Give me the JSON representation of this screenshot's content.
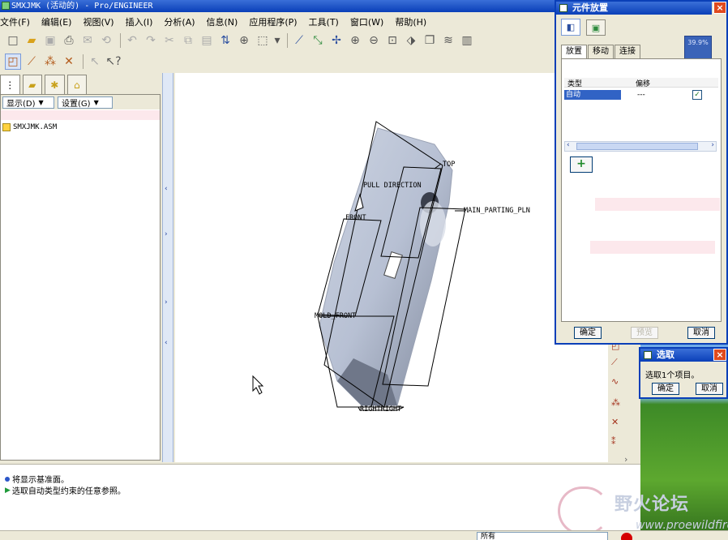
{
  "window": {
    "title": "SMXJMK (活动的) - Pro/ENGINEER"
  },
  "menu": [
    "文件(F)",
    "编辑(E)",
    "视图(V)",
    "插入(I)",
    "分析(A)",
    "信息(N)",
    "应用程序(P)",
    "工具(T)",
    "窗口(W)",
    "帮助(H)"
  ],
  "model_tree": {
    "show_label": "显示(D)",
    "settings_label": "设置(G)",
    "root_item": "SMXJMK.ASM"
  },
  "datums": {
    "top": "TOP",
    "pull_direction": "PULL DIRECTION",
    "main_parting": "MAIN_PARTING_PLN",
    "front": "FRONT",
    "mold_front": "MOLD_FRONT",
    "right": "RIGHTRIGHT"
  },
  "messages": [
    "将显示基准面。",
    "选取自动类型约束的任意参照。"
  ],
  "status": {
    "filter_value": "所有"
  },
  "component_placement": {
    "title": "元件放置",
    "progress": "39.9%",
    "tabs": [
      "放置",
      "移动",
      "连接"
    ],
    "columns": {
      "type": "类型",
      "offset": "偏移"
    },
    "row": {
      "type": "自动",
      "offset": "---",
      "checked": true
    },
    "buttons": {
      "ok": "确定",
      "preview": "预览",
      "cancel": "取消"
    }
  },
  "select_dialog": {
    "title": "选取",
    "message": "选取1个项目。",
    "ok": "确定",
    "cancel": "取消"
  },
  "watermark": {
    "text": "野火论坛",
    "url": "www.proewildfire.cn"
  }
}
